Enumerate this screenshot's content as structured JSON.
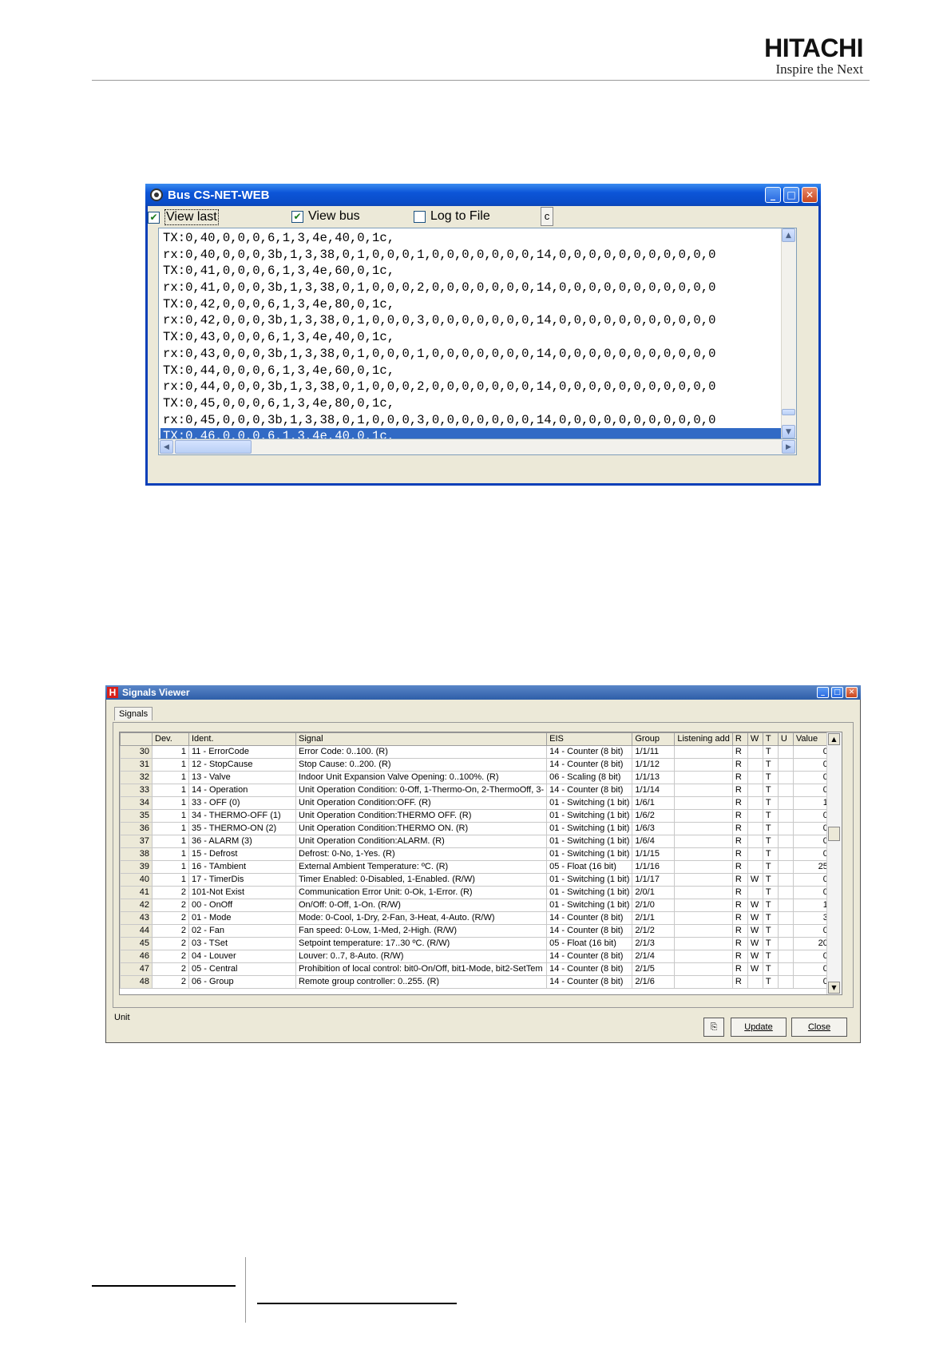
{
  "brand": {
    "logo": "HITACHI",
    "tagline": "Inspire the Next"
  },
  "bus_window": {
    "title": "Bus CS-NET-WEB",
    "view_last": {
      "label": "View last",
      "checked": true
    },
    "view_bus": {
      "label": "View bus",
      "checked": true
    },
    "log_to_file": {
      "label": "Log to File",
      "checked": false
    },
    "clear_label": "c",
    "lines": [
      "TX:0,40,0,0,0,6,1,3,4e,40,0,1c,",
      "rx:0,40,0,0,0,3b,1,3,38,0,1,0,0,0,1,0,0,0,0,0,0,0,14,0,0,0,0,0,0,0,0,0,0,0",
      "TX:0,41,0,0,0,6,1,3,4e,60,0,1c,",
      "rx:0,41,0,0,0,3b,1,3,38,0,1,0,0,0,2,0,0,0,0,0,0,0,14,0,0,0,0,0,0,0,0,0,0,0",
      "TX:0,42,0,0,0,6,1,3,4e,80,0,1c,",
      "rx:0,42,0,0,0,3b,1,3,38,0,1,0,0,0,3,0,0,0,0,0,0,0,14,0,0,0,0,0,0,0,0,0,0,0",
      "TX:0,43,0,0,0,6,1,3,4e,40,0,1c,",
      "rx:0,43,0,0,0,3b,1,3,38,0,1,0,0,0,1,0,0,0,0,0,0,0,14,0,0,0,0,0,0,0,0,0,0,0",
      "TX:0,44,0,0,0,6,1,3,4e,60,0,1c,",
      "rx:0,44,0,0,0,3b,1,3,38,0,1,0,0,0,2,0,0,0,0,0,0,0,14,0,0,0,0,0,0,0,0,0,0,0",
      "TX:0,45,0,0,0,6,1,3,4e,80,0,1c,",
      "rx:0,45,0,0,0,3b,1,3,38,0,1,0,0,0,3,0,0,0,0,0,0,0,14,0,0,0,0,0,0,0,0,0,0,0",
      "TX:0,46,0,0,0,6,1,3,4e,40,0,1c,"
    ],
    "selected_line": 12
  },
  "signals_window": {
    "title": "Signals Viewer",
    "tab": "Signals",
    "columns": [
      "",
      "Dev.",
      "Ident.",
      "Signal",
      "EIS",
      "Group",
      "Listening add",
      "R",
      "W",
      "T",
      "U",
      "Value"
    ],
    "rows": [
      [
        "30",
        "1",
        "11 - ErrorCode",
        "Error Code: 0..100. (R)",
        "14 - Counter (8 bit)",
        "1/1/11",
        "",
        "R",
        "",
        "T",
        "",
        "0"
      ],
      [
        "31",
        "1",
        "12 - StopCause",
        "Stop Cause: 0..200. (R)",
        "14 - Counter (8 bit)",
        "1/1/12",
        "",
        "R",
        "",
        "T",
        "",
        "0"
      ],
      [
        "32",
        "1",
        "13 - Valve",
        "Indoor Unit Expansion Valve Opening: 0..100%. (R)",
        "06 - Scaling (8 bit)",
        "1/1/13",
        "",
        "R",
        "",
        "T",
        "",
        "0"
      ],
      [
        "33",
        "1",
        "14 - Operation",
        "Unit Operation Condition: 0-Off, 1-Thermo-On, 2-ThermoOff, 3-",
        "14 - Counter (8 bit)",
        "1/1/14",
        "",
        "R",
        "",
        "T",
        "",
        "0"
      ],
      [
        "34",
        "1",
        "33 - OFF (0)",
        "Unit Operation Condition:OFF. (R)",
        "01 - Switching (1 bit)",
        "1/6/1",
        "",
        "R",
        "",
        "T",
        "",
        "1"
      ],
      [
        "35",
        "1",
        "34 - THERMO-OFF (1)",
        "Unit Operation Condition:THERMO OFF. (R)",
        "01 - Switching (1 bit)",
        "1/6/2",
        "",
        "R",
        "",
        "T",
        "",
        "0"
      ],
      [
        "36",
        "1",
        "35 - THERMO-ON (2)",
        "Unit Operation Condition:THERMO ON. (R)",
        "01 - Switching (1 bit)",
        "1/6/3",
        "",
        "R",
        "",
        "T",
        "",
        "0"
      ],
      [
        "37",
        "1",
        "36 - ALARM (3)",
        "Unit Operation Condition:ALARM. (R)",
        "01 - Switching (1 bit)",
        "1/6/4",
        "",
        "R",
        "",
        "T",
        "",
        "0"
      ],
      [
        "38",
        "1",
        "15 - Defrost",
        "Defrost: 0-No, 1-Yes. (R)",
        "01 - Switching (1 bit)",
        "1/1/15",
        "",
        "R",
        "",
        "T",
        "",
        "0"
      ],
      [
        "39",
        "1",
        "16 - TAmbient",
        "External Ambient Temperature: ºC. (R)",
        "05 - Float (16 bit)",
        "1/1/16",
        "",
        "R",
        "",
        "T",
        "",
        "25"
      ],
      [
        "40",
        "1",
        "17 - TimerDis",
        "Timer Enabled: 0-Disabled, 1-Enabled. (R/W)",
        "01 - Switching (1 bit)",
        "1/1/17",
        "",
        "R",
        "W",
        "T",
        "",
        "0"
      ],
      [
        "41",
        "2",
        "101-Not Exist",
        "Communication Error Unit: 0-Ok, 1-Error. (R)",
        "01 - Switching (1 bit)",
        "2/0/1",
        "",
        "R",
        "",
        "T",
        "",
        "0"
      ],
      [
        "42",
        "2",
        "00 - OnOff",
        "On/Off: 0-Off, 1-On. (R/W)",
        "01 - Switching (1 bit)",
        "2/1/0",
        "",
        "R",
        "W",
        "T",
        "",
        "1"
      ],
      [
        "43",
        "2",
        "01 - Mode",
        "Mode: 0-Cool, 1-Dry, 2-Fan, 3-Heat, 4-Auto. (R/W)",
        "14 - Counter (8 bit)",
        "2/1/1",
        "",
        "R",
        "W",
        "T",
        "",
        "3"
      ],
      [
        "44",
        "2",
        "02 - Fan",
        "Fan speed: 0-Low, 1-Med, 2-High. (R/W)",
        "14 - Counter (8 bit)",
        "2/1/2",
        "",
        "R",
        "W",
        "T",
        "",
        "0"
      ],
      [
        "45",
        "2",
        "03 - TSet",
        "Setpoint temperature: 17..30 ºC. (R/W)",
        "05 - Float (16 bit)",
        "2/1/3",
        "",
        "R",
        "W",
        "T",
        "",
        "20"
      ],
      [
        "46",
        "2",
        "04 - Louver",
        "Louver: 0..7, 8-Auto. (R/W)",
        "14 - Counter (8 bit)",
        "2/1/4",
        "",
        "R",
        "W",
        "T",
        "",
        "0"
      ],
      [
        "47",
        "2",
        "05 - Central",
        "Prohibition of local control: bit0-On/Off, bit1-Mode, bit2-SetTem",
        "14 - Counter (8 bit)",
        "2/1/5",
        "",
        "R",
        "W",
        "T",
        "",
        "0"
      ],
      [
        "48",
        "2",
        "06 - Group",
        "Remote group controller: 0..255. (R)",
        "14 - Counter (8 bit)",
        "2/1/6",
        "",
        "R",
        "",
        "T",
        "",
        "0"
      ]
    ],
    "status_label": "Unit",
    "update_label": "Update",
    "close_label": "Close"
  }
}
